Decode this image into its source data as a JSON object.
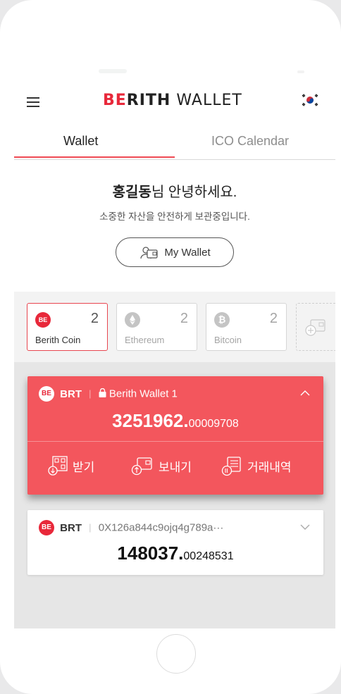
{
  "brand": {
    "accent": "BE",
    "strong": "RITH",
    "light": "WALLET"
  },
  "tabs": [
    {
      "label": "Wallet"
    },
    {
      "label": "ICO Calendar"
    }
  ],
  "greeting": {
    "name": "홍길동",
    "suffix": "님 안녕하세요.",
    "sub": "소중한 자산을 안전하게 보관중입니다."
  },
  "my_wallet_label": "My Wallet",
  "tokens": [
    {
      "name": "Berith Coin",
      "count": "2",
      "icon": "berith-coin-icon"
    },
    {
      "name": "Ethereum",
      "count": "2",
      "icon": "ethereum-icon"
    },
    {
      "name": "Bitcoin",
      "count": "2",
      "icon": "bitcoin-icon"
    }
  ],
  "wallets": [
    {
      "symbol": "BRT",
      "label": "Berith Wallet 1",
      "amount_int": "3251962",
      "amount_frac": "00009708"
    },
    {
      "symbol": "BRT",
      "label": "0X126a844c9ojq4g789a···",
      "amount_int": "148037",
      "amount_frac": "00248531"
    }
  ],
  "actions": [
    {
      "label": "받기"
    },
    {
      "label": "보내기"
    },
    {
      "label": "거래내역"
    }
  ],
  "coin_badge_text": "BE",
  "colors": {
    "accent": "#e8283a",
    "card_red": "#f3565d",
    "tab_underline": "#ef4a53"
  }
}
